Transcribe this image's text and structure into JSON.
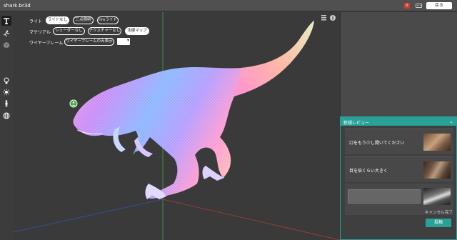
{
  "app": {
    "title": "shark.br3d",
    "back_label": "戻る",
    "notification_count": "0"
  },
  "toolbar": {
    "tools": [
      "transform-icon",
      "animation-icon",
      "cube-icon",
      "lightbulb-icon",
      "sun-icon",
      "person-icon",
      "globe-icon"
    ]
  },
  "viewport": {
    "light": {
      "label": "ライト",
      "options": [
        "ライトなし",
        "三点照明",
        "rimライト"
      ],
      "selected": 0
    },
    "material": {
      "label": "マテリアル",
      "options": [
        "シェーダーなし",
        "テクスチャーなし",
        "法線マップ"
      ],
      "selected": 2
    },
    "wireframe": {
      "label": "ワイヤーフレーム",
      "option": "ワイヤーフレームのみ表示",
      "color": "#ffffff"
    }
  },
  "review": {
    "title": "新規レビュー",
    "comments": [
      {
        "text": "口をもう少し開いてください"
      },
      {
        "text": "目を倍くらい大きく"
      }
    ],
    "input_placeholder": "",
    "cancel_label": "キャンセル",
    "done_label": "完了",
    "post_label": "投稿"
  },
  "colors": {
    "accent": "#2aa198",
    "notification": "#d23b2c"
  }
}
